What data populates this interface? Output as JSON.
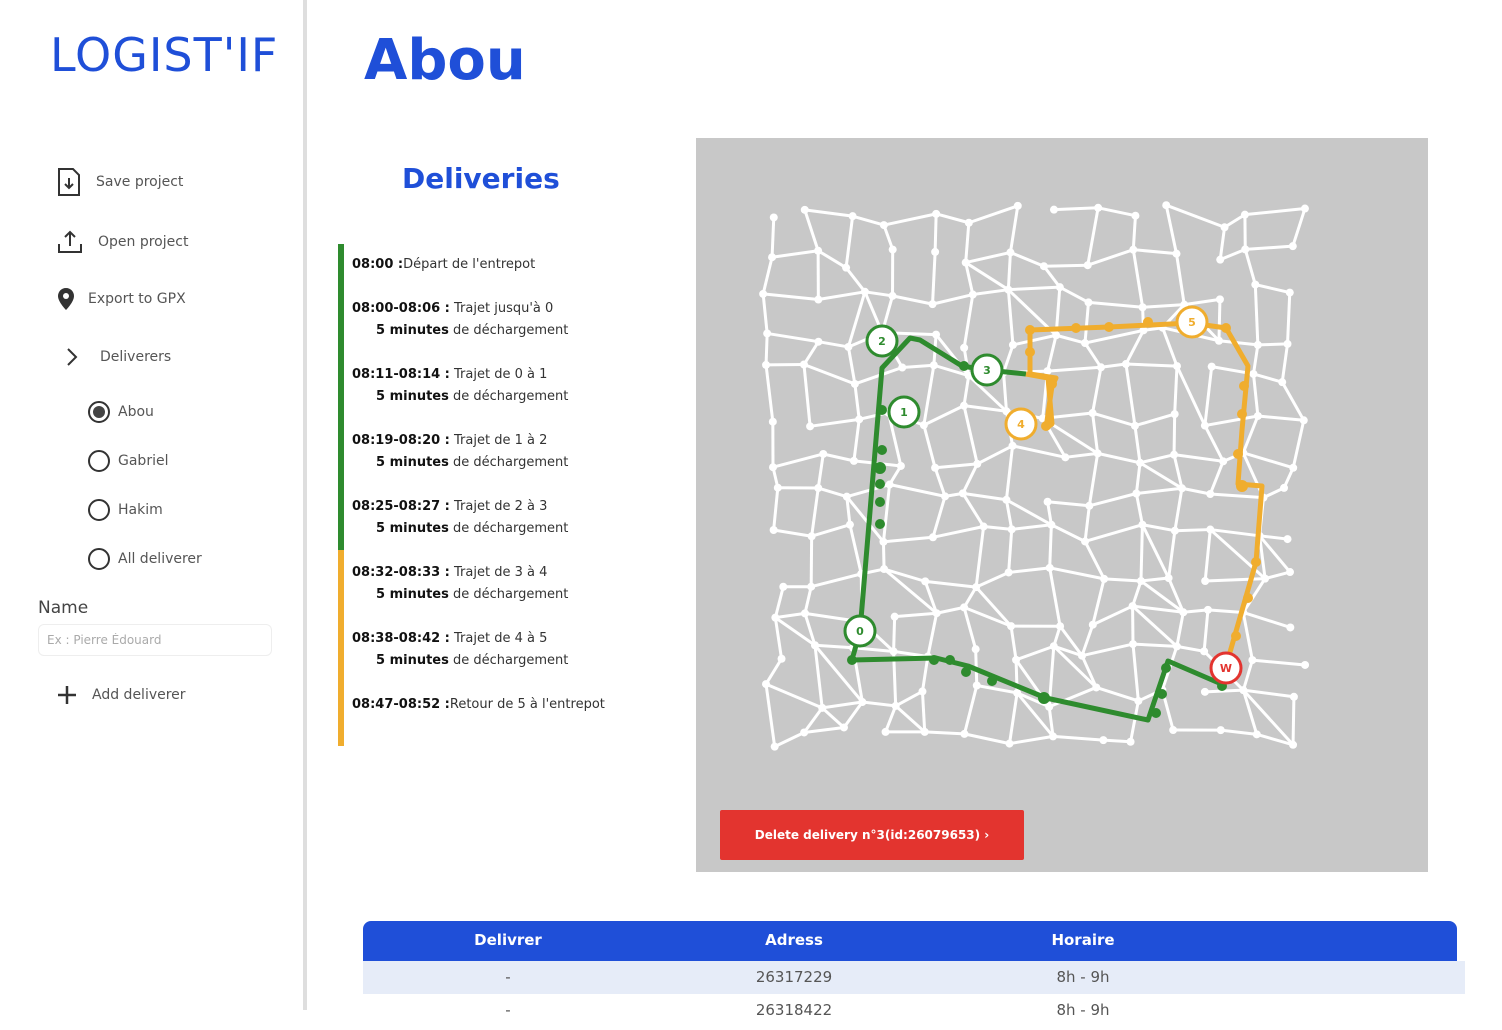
{
  "sidebar": {
    "logo_text": "LOGIST'IF",
    "menu": {
      "save": "Save project",
      "open": "Open project",
      "export": "Export to GPX",
      "deliverers": "Deliverers"
    },
    "deliverers": [
      {
        "name": "Abou",
        "selected": true
      },
      {
        "name": "Gabriel",
        "selected": false
      },
      {
        "name": "Hakim",
        "selected": false
      },
      {
        "name": "All deliverer",
        "selected": false
      }
    ],
    "name_label": "Name",
    "name_placeholder": "Ex : Pierre Édouard",
    "add_deliverer": "Add deliverer"
  },
  "main": {
    "title": "Abou",
    "deliveries_title": "Deliveries",
    "timeline": [
      {
        "time": "08:00 :",
        "text": "Départ de l'entrepot",
        "unload": null,
        "color": "#2e8b2e"
      },
      {
        "time": "08:00-08:06 :",
        "text": "Trajet jusqu'à 0",
        "unload": "5 minutes",
        "unload_text": "de déchargement",
        "color": "#2e8b2e"
      },
      {
        "time": "08:11-08:14 :",
        "text": "Trajet de 0 à 1",
        "unload": "5 minutes",
        "unload_text": "de déchargement",
        "color": "#2e8b2e"
      },
      {
        "time": "08:19-08:20 :",
        "text": "Trajet de 1 à 2",
        "unload": "5 minutes",
        "unload_text": "de déchargement",
        "color": "#2e8b2e"
      },
      {
        "time": "08:25-08:27 :",
        "text": "Trajet de 2 à 3",
        "unload": "5 minutes",
        "unload_text": "de déchargement",
        "color": "#2e8b2e"
      },
      {
        "time": "08:32-08:33 :",
        "text": "Trajet de 3 à 4",
        "unload": "5 minutes",
        "unload_text": "de déchargement",
        "color": "#f0ad2e"
      },
      {
        "time": "08:38-08:42 :",
        "text": "Trajet de 4 à 5",
        "unload": "5 minutes",
        "unload_text": "de déchargement",
        "color": "#f0ad2e"
      },
      {
        "time": "08:47-08:52 :",
        "text": "Retour de 5 à l'entrepot",
        "unload": null,
        "color": "#f0ad2e"
      }
    ],
    "map_markers": [
      "0",
      "1",
      "2",
      "3",
      "4",
      "5",
      "W"
    ],
    "delete_button": "Delete delivery n°3(id:26079653) ›",
    "table": {
      "headers": [
        "Delivrer",
        "Adress",
        "Horaire"
      ],
      "rows": [
        [
          "-",
          "26317229",
          "8h - 9h"
        ],
        [
          "-",
          "26318422",
          "8h - 9h"
        ]
      ]
    }
  },
  "colors": {
    "brand_blue": "#1f4fd8",
    "route_green": "#2e8b2e",
    "route_orange": "#f0ad2e",
    "danger_red": "#e3342f",
    "map_bg": "#c8c8c8"
  }
}
